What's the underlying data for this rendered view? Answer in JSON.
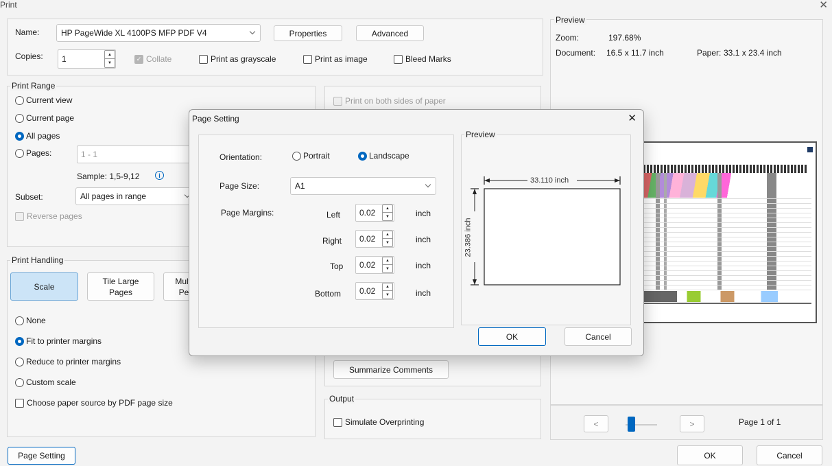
{
  "window": {
    "title": "Print",
    "close_icon": "close-icon"
  },
  "printer": {
    "name_label": "Name:",
    "name_value": "HP PageWide XL 4100PS MFP PDF V4",
    "properties": "Properties",
    "advanced": "Advanced",
    "copies_label": "Copies:",
    "copies_value": "1",
    "collate": "Collate",
    "grayscale": "Print as grayscale",
    "as_image": "Print as image",
    "bleed": "Bleed Marks"
  },
  "print_range": {
    "title": "Print Range",
    "current_view": "Current view",
    "current_page": "Current page",
    "all_pages": "All pages",
    "pages": "Pages:",
    "pages_value": "1 - 1",
    "sample": "Sample: 1,5-9,12",
    "subset_label": "Subset:",
    "subset_value": "All pages in range",
    "reverse": "Reverse pages"
  },
  "right_panel": {
    "both_sides": "Print on both sides of paper"
  },
  "print_handling": {
    "title": "Print Handling",
    "scale": "Scale",
    "tile_line1": "Tile Large",
    "tile_line2": "Pages",
    "multi_line1": "Multi",
    "multi_line2": "Pe",
    "none": "None",
    "fit": "Fit to printer margins",
    "reduce": "Reduce to printer margins",
    "custom": "Custom scale",
    "paper_source": "Choose paper source by PDF page size"
  },
  "comments": {
    "summarize": "Summarize Comments"
  },
  "output": {
    "title": "Output",
    "simulate": "Simulate Overprinting"
  },
  "preview": {
    "title": "Preview",
    "zoom_label": "Zoom:",
    "zoom_value": "197.68%",
    "document_label": "Document:",
    "document_value": "16.5 x 11.7 inch",
    "paper_label": "Paper:",
    "paper_value": "33.1 x 23.4 inch",
    "prev": "<",
    "next": ">",
    "page_info": "Page 1 of 1",
    "slider_fraction": 0.1
  },
  "footer": {
    "page_setting": "Page Setting",
    "ok": "OK",
    "cancel": "Cancel"
  },
  "dialog": {
    "title": "Page Setting",
    "orientation_label": "Orientation:",
    "portrait": "Portrait",
    "landscape": "Landscape",
    "page_size_label": "Page Size:",
    "page_size_value": "A1",
    "margins_label": "Page Margins:",
    "margins": [
      {
        "label": "Left",
        "value": "0.02",
        "unit": "inch"
      },
      {
        "label": "Right",
        "value": "0.02",
        "unit": "inch"
      },
      {
        "label": "Top",
        "value": "0.02",
        "unit": "inch"
      },
      {
        "label": "Bottom",
        "value": "0.02",
        "unit": "inch"
      }
    ],
    "preview_title": "Preview",
    "width_dim": "33.110 inch",
    "height_dim": "23.386 inch",
    "ok": "OK",
    "cancel": "Cancel"
  }
}
